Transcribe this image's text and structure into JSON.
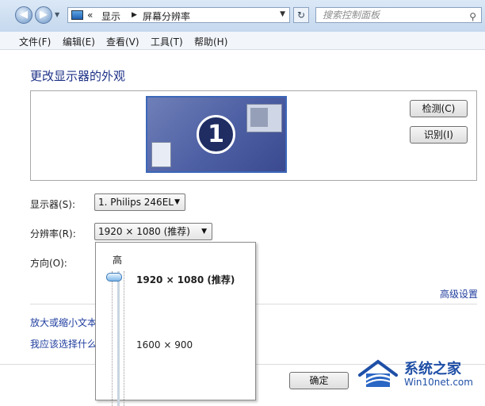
{
  "address_bar": {
    "overflow": "«",
    "crumbs": [
      "显示",
      "屏幕分辨率"
    ],
    "search_placeholder": "搜索控制面板"
  },
  "menu": [
    "文件(F)",
    "编辑(E)",
    "查看(V)",
    "工具(T)",
    "帮助(H)"
  ],
  "main": {
    "heading": "更改显示器的外观",
    "monitor_number": "1",
    "detect_button": "检测(C)",
    "identify_button": "识别(I)",
    "display_label": "显示器(S):",
    "display_value": "1. Philips 246EL",
    "resolution_label": "分辨率(R):",
    "resolution_value": "1920 × 1080 (推荐)",
    "orientation_label": "方向(O):",
    "advanced_link": "高级设置",
    "link_text_size": "放大或缩小文本",
    "link_which_settings": "我应该选择什么",
    "ok_button": "确定"
  },
  "resolution_popup": {
    "high_label": "高",
    "options": [
      "1920 × 1080 (推荐)",
      "1600 × 900"
    ],
    "selected_index": 0
  },
  "watermark": {
    "title": "系统之家",
    "url": "Win10net.com"
  },
  "colors": {
    "heading": "#1e3287",
    "link": "#1e3c9e",
    "monitor_border": "#3c67b8"
  }
}
